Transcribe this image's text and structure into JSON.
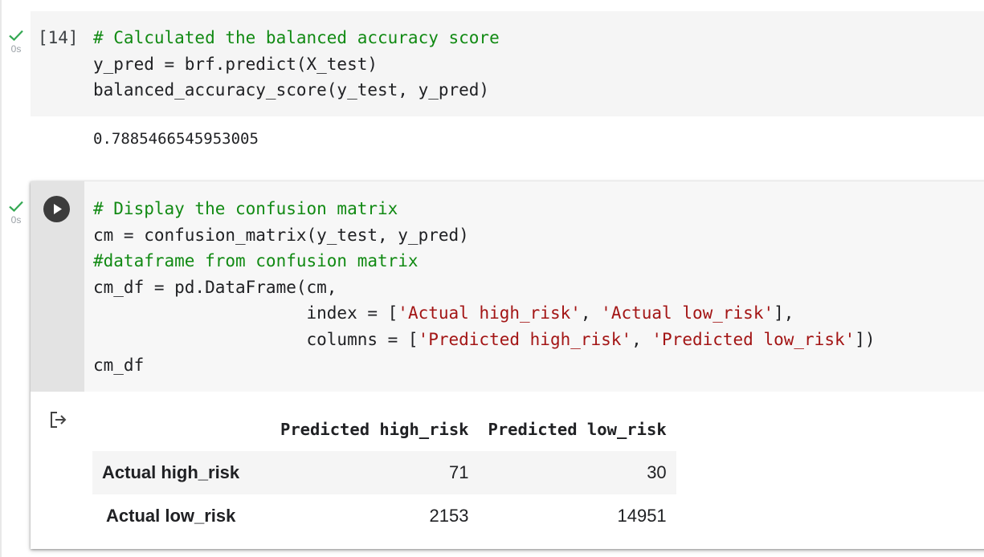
{
  "colors": {
    "comment": "#118a13",
    "string": "#a31515",
    "check": "#34a853",
    "text": "#202124"
  },
  "cell1": {
    "status_icon": "check-icon",
    "exec_time": "0s",
    "exec_count": "[14]",
    "code": {
      "line1": "# Calculated the balanced accuracy score",
      "line2": "y_pred = brf.predict(X_test)",
      "line3": "balanced_accuracy_score(y_test, y_pred)"
    },
    "output": "0.7885466545953005"
  },
  "cell2": {
    "status_icon": "check-icon",
    "exec_time": "0s",
    "run_icon": "play-icon",
    "output_icon": "output-redirect-icon",
    "code": {
      "l1_comment": "# Display the confusion matrix",
      "l2": "cm = confusion_matrix(y_test, y_pred)",
      "l3_comment": "#dataframe from confusion matrix",
      "l4": "cm_df = pd.DataFrame(cm,",
      "l5_pre": "                     index = [",
      "l5_s1": "'Actual high_risk'",
      "l5_mid": ", ",
      "l5_s2": "'Actual low_risk'",
      "l5_post": "],",
      "l6_pre": "                     columns = [",
      "l6_s1": "'Predicted high_risk'",
      "l6_mid": ", ",
      "l6_s2": "'Predicted low_risk'",
      "l6_post": "])",
      "l7": "cm_df"
    },
    "dataframe": {
      "columns": [
        "Predicted high_risk",
        "Predicted low_risk"
      ],
      "rows": [
        {
          "index": "Actual high_risk",
          "values": [
            "71",
            "30"
          ]
        },
        {
          "index": "Actual low_risk",
          "values": [
            "2153",
            "14951"
          ]
        }
      ]
    }
  }
}
